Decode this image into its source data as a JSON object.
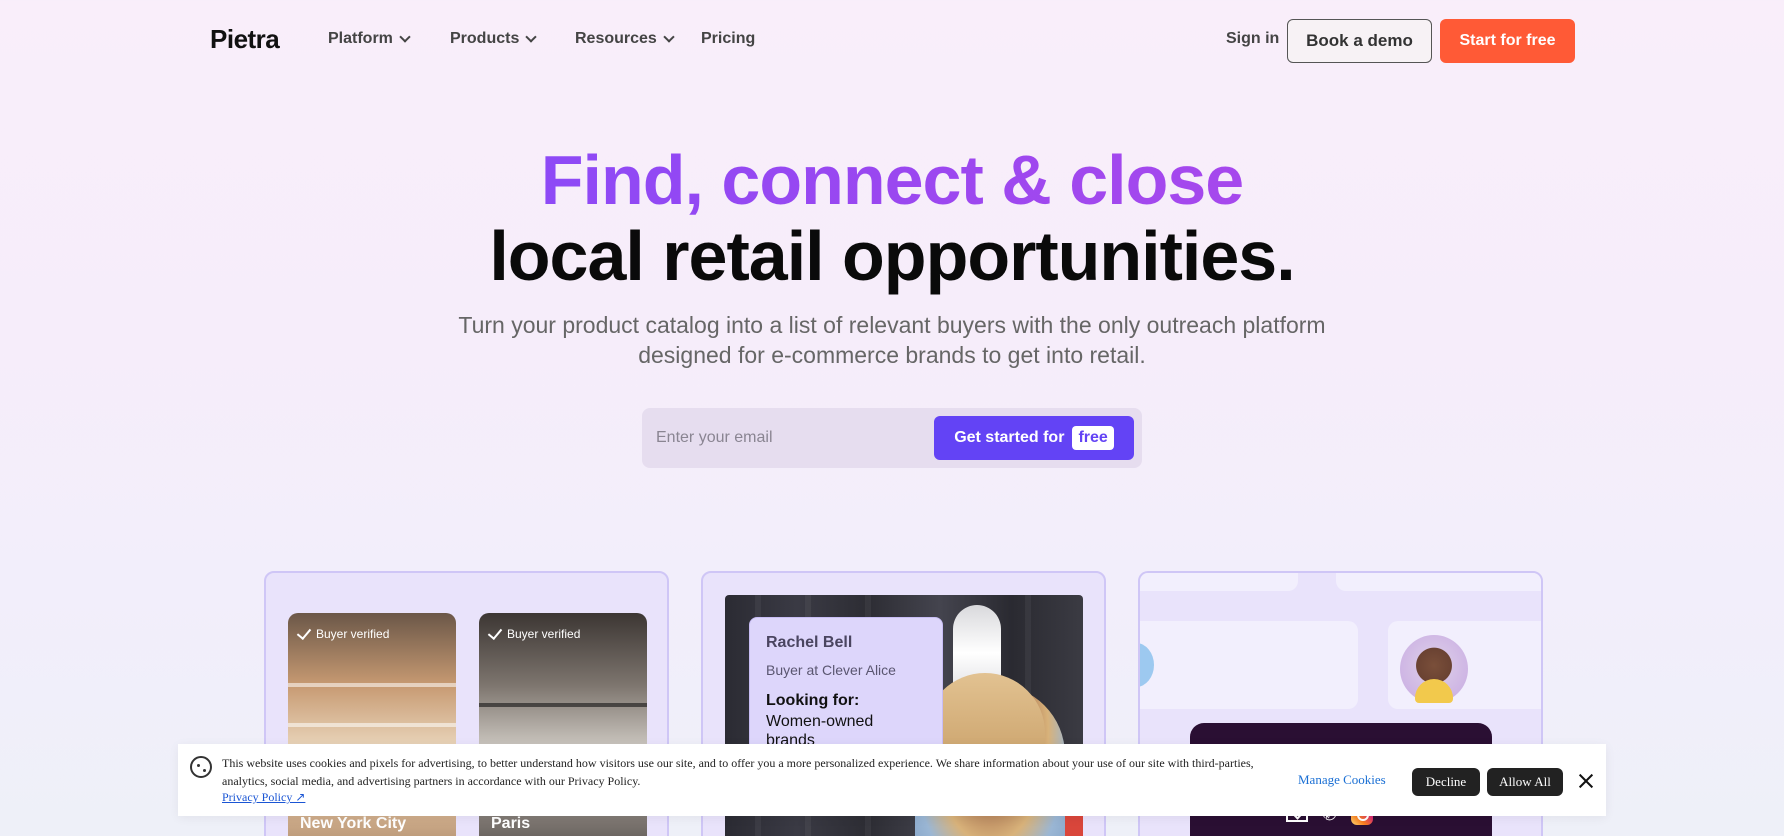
{
  "nav": {
    "logo": "Pietra",
    "items": [
      {
        "label": "Platform"
      },
      {
        "label": "Products"
      },
      {
        "label": "Resources"
      },
      {
        "label": "Pricing"
      }
    ],
    "sign_in": "Sign in",
    "book_demo": "Book a demo",
    "start_free": "Start for free"
  },
  "hero": {
    "line1": "Find, connect & close",
    "line2": "local retail opportunities.",
    "subtitle": "Turn your product catalog into a list of relevant buyers with the only outreach platform designed for e-commerce brands to get into retail.",
    "email_placeholder": "Enter your email",
    "cta_label": "Get started for",
    "cta_badge": "free",
    "colors": {
      "gradient_start": "#7b4dff",
      "gradient_end": "#b94ae8",
      "cta": "#6343f5",
      "start_button": "#ff5a36"
    }
  },
  "cards": {
    "stores": [
      {
        "badge": "Buyer verified",
        "city": "New York City"
      },
      {
        "badge": "Buyer verified",
        "city": "Paris"
      }
    ],
    "buyer": {
      "name": "Rachel Bell",
      "role": "Buyer at Clever Alice",
      "looking_label": "Looking for:",
      "looking_value": "Women-owned brands"
    },
    "contact_icons": [
      "mail-icon",
      "phone-icon",
      "instagram-icon"
    ]
  },
  "cookie": {
    "text": "This website uses cookies and pixels for advertising, to better understand how visitors use our site, and to offer you a more personalized experience. We share information about your use of our site with third-parties, analytics, social media, and advertising partners in accordance with our Privacy Policy.",
    "privacy_link": "Privacy Policy ↗",
    "manage": "Manage Cookies",
    "decline": "Decline",
    "allow_all": "Allow All"
  }
}
